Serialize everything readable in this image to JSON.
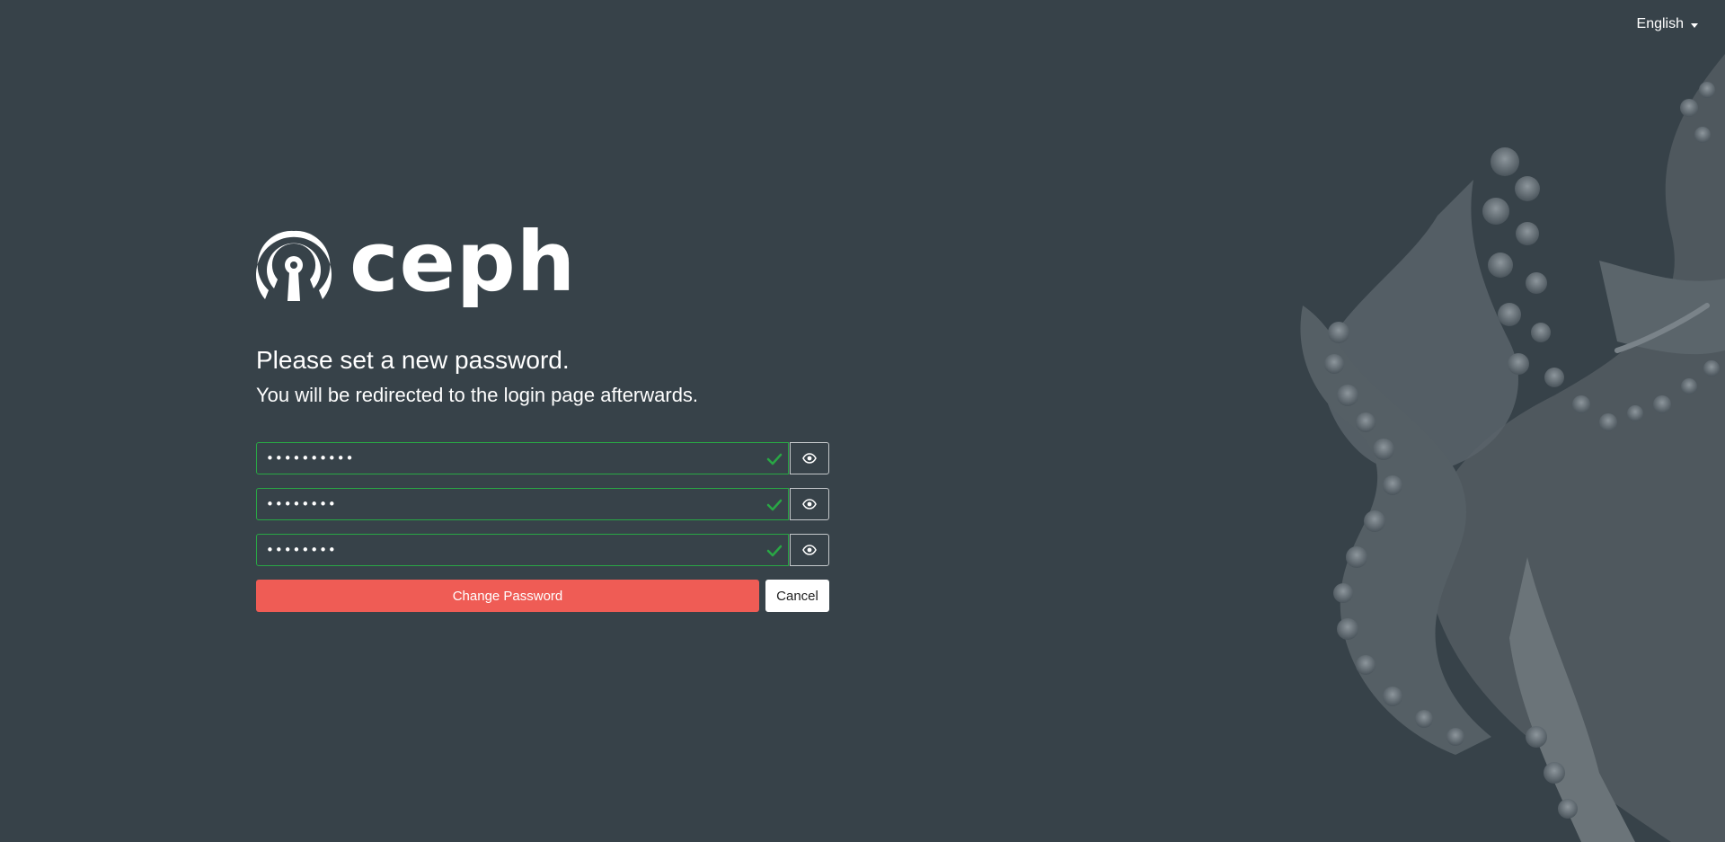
{
  "language": {
    "selected": "English",
    "icon": "caret-down-icon"
  },
  "logo": {
    "wordmark": "ceph",
    "icon": "ceph-logo-icon"
  },
  "heading": {
    "title": "Please set a new password.",
    "subtitle": "You will be redirected to the login page afterwards."
  },
  "form": {
    "fields": [
      {
        "value": "••••••••••",
        "status": "valid",
        "status_icon": "check-icon",
        "toggle_icon": "eye-icon"
      },
      {
        "value": "••••••••",
        "status": "valid",
        "status_icon": "check-icon",
        "toggle_icon": "eye-icon"
      },
      {
        "value": "••••••••",
        "status": "valid",
        "status_icon": "check-icon",
        "toggle_icon": "eye-icon"
      }
    ],
    "submit_label": "Change Password",
    "cancel_label": "Cancel"
  },
  "colors": {
    "background": "#374249",
    "accent": "#ef5c55",
    "valid": "#29a745",
    "text": "#ffffff"
  },
  "decoration": {
    "icon": "octopus-illustration"
  }
}
